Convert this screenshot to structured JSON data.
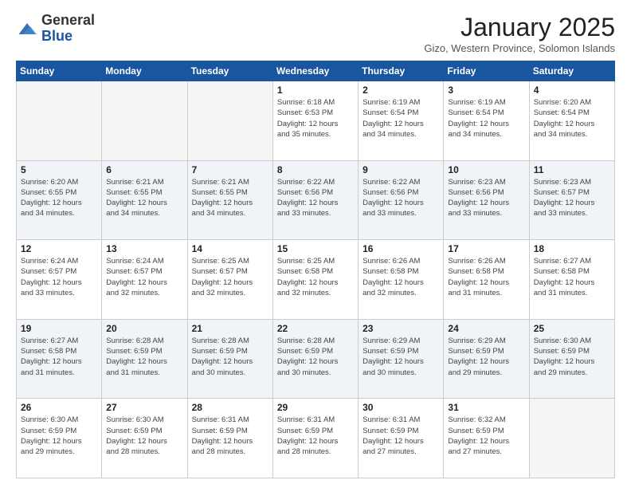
{
  "header": {
    "logo_general": "General",
    "logo_blue": "Blue",
    "month_title": "January 2025",
    "subtitle": "Gizo, Western Province, Solomon Islands"
  },
  "days_of_week": [
    "Sunday",
    "Monday",
    "Tuesday",
    "Wednesday",
    "Thursday",
    "Friday",
    "Saturday"
  ],
  "weeks": [
    [
      {
        "num": "",
        "info": ""
      },
      {
        "num": "",
        "info": ""
      },
      {
        "num": "",
        "info": ""
      },
      {
        "num": "1",
        "info": "Sunrise: 6:18 AM\nSunset: 6:53 PM\nDaylight: 12 hours\nand 35 minutes."
      },
      {
        "num": "2",
        "info": "Sunrise: 6:19 AM\nSunset: 6:54 PM\nDaylight: 12 hours\nand 34 minutes."
      },
      {
        "num": "3",
        "info": "Sunrise: 6:19 AM\nSunset: 6:54 PM\nDaylight: 12 hours\nand 34 minutes."
      },
      {
        "num": "4",
        "info": "Sunrise: 6:20 AM\nSunset: 6:54 PM\nDaylight: 12 hours\nand 34 minutes."
      }
    ],
    [
      {
        "num": "5",
        "info": "Sunrise: 6:20 AM\nSunset: 6:55 PM\nDaylight: 12 hours\nand 34 minutes."
      },
      {
        "num": "6",
        "info": "Sunrise: 6:21 AM\nSunset: 6:55 PM\nDaylight: 12 hours\nand 34 minutes."
      },
      {
        "num": "7",
        "info": "Sunrise: 6:21 AM\nSunset: 6:55 PM\nDaylight: 12 hours\nand 34 minutes."
      },
      {
        "num": "8",
        "info": "Sunrise: 6:22 AM\nSunset: 6:56 PM\nDaylight: 12 hours\nand 33 minutes."
      },
      {
        "num": "9",
        "info": "Sunrise: 6:22 AM\nSunset: 6:56 PM\nDaylight: 12 hours\nand 33 minutes."
      },
      {
        "num": "10",
        "info": "Sunrise: 6:23 AM\nSunset: 6:56 PM\nDaylight: 12 hours\nand 33 minutes."
      },
      {
        "num": "11",
        "info": "Sunrise: 6:23 AM\nSunset: 6:57 PM\nDaylight: 12 hours\nand 33 minutes."
      }
    ],
    [
      {
        "num": "12",
        "info": "Sunrise: 6:24 AM\nSunset: 6:57 PM\nDaylight: 12 hours\nand 33 minutes."
      },
      {
        "num": "13",
        "info": "Sunrise: 6:24 AM\nSunset: 6:57 PM\nDaylight: 12 hours\nand 32 minutes."
      },
      {
        "num": "14",
        "info": "Sunrise: 6:25 AM\nSunset: 6:57 PM\nDaylight: 12 hours\nand 32 minutes."
      },
      {
        "num": "15",
        "info": "Sunrise: 6:25 AM\nSunset: 6:58 PM\nDaylight: 12 hours\nand 32 minutes."
      },
      {
        "num": "16",
        "info": "Sunrise: 6:26 AM\nSunset: 6:58 PM\nDaylight: 12 hours\nand 32 minutes."
      },
      {
        "num": "17",
        "info": "Sunrise: 6:26 AM\nSunset: 6:58 PM\nDaylight: 12 hours\nand 31 minutes."
      },
      {
        "num": "18",
        "info": "Sunrise: 6:27 AM\nSunset: 6:58 PM\nDaylight: 12 hours\nand 31 minutes."
      }
    ],
    [
      {
        "num": "19",
        "info": "Sunrise: 6:27 AM\nSunset: 6:58 PM\nDaylight: 12 hours\nand 31 minutes."
      },
      {
        "num": "20",
        "info": "Sunrise: 6:28 AM\nSunset: 6:59 PM\nDaylight: 12 hours\nand 31 minutes."
      },
      {
        "num": "21",
        "info": "Sunrise: 6:28 AM\nSunset: 6:59 PM\nDaylight: 12 hours\nand 30 minutes."
      },
      {
        "num": "22",
        "info": "Sunrise: 6:28 AM\nSunset: 6:59 PM\nDaylight: 12 hours\nand 30 minutes."
      },
      {
        "num": "23",
        "info": "Sunrise: 6:29 AM\nSunset: 6:59 PM\nDaylight: 12 hours\nand 30 minutes."
      },
      {
        "num": "24",
        "info": "Sunrise: 6:29 AM\nSunset: 6:59 PM\nDaylight: 12 hours\nand 29 minutes."
      },
      {
        "num": "25",
        "info": "Sunrise: 6:30 AM\nSunset: 6:59 PM\nDaylight: 12 hours\nand 29 minutes."
      }
    ],
    [
      {
        "num": "26",
        "info": "Sunrise: 6:30 AM\nSunset: 6:59 PM\nDaylight: 12 hours\nand 29 minutes."
      },
      {
        "num": "27",
        "info": "Sunrise: 6:30 AM\nSunset: 6:59 PM\nDaylight: 12 hours\nand 28 minutes."
      },
      {
        "num": "28",
        "info": "Sunrise: 6:31 AM\nSunset: 6:59 PM\nDaylight: 12 hours\nand 28 minutes."
      },
      {
        "num": "29",
        "info": "Sunrise: 6:31 AM\nSunset: 6:59 PM\nDaylight: 12 hours\nand 28 minutes."
      },
      {
        "num": "30",
        "info": "Sunrise: 6:31 AM\nSunset: 6:59 PM\nDaylight: 12 hours\nand 27 minutes."
      },
      {
        "num": "31",
        "info": "Sunrise: 6:32 AM\nSunset: 6:59 PM\nDaylight: 12 hours\nand 27 minutes."
      },
      {
        "num": "",
        "info": ""
      }
    ]
  ]
}
